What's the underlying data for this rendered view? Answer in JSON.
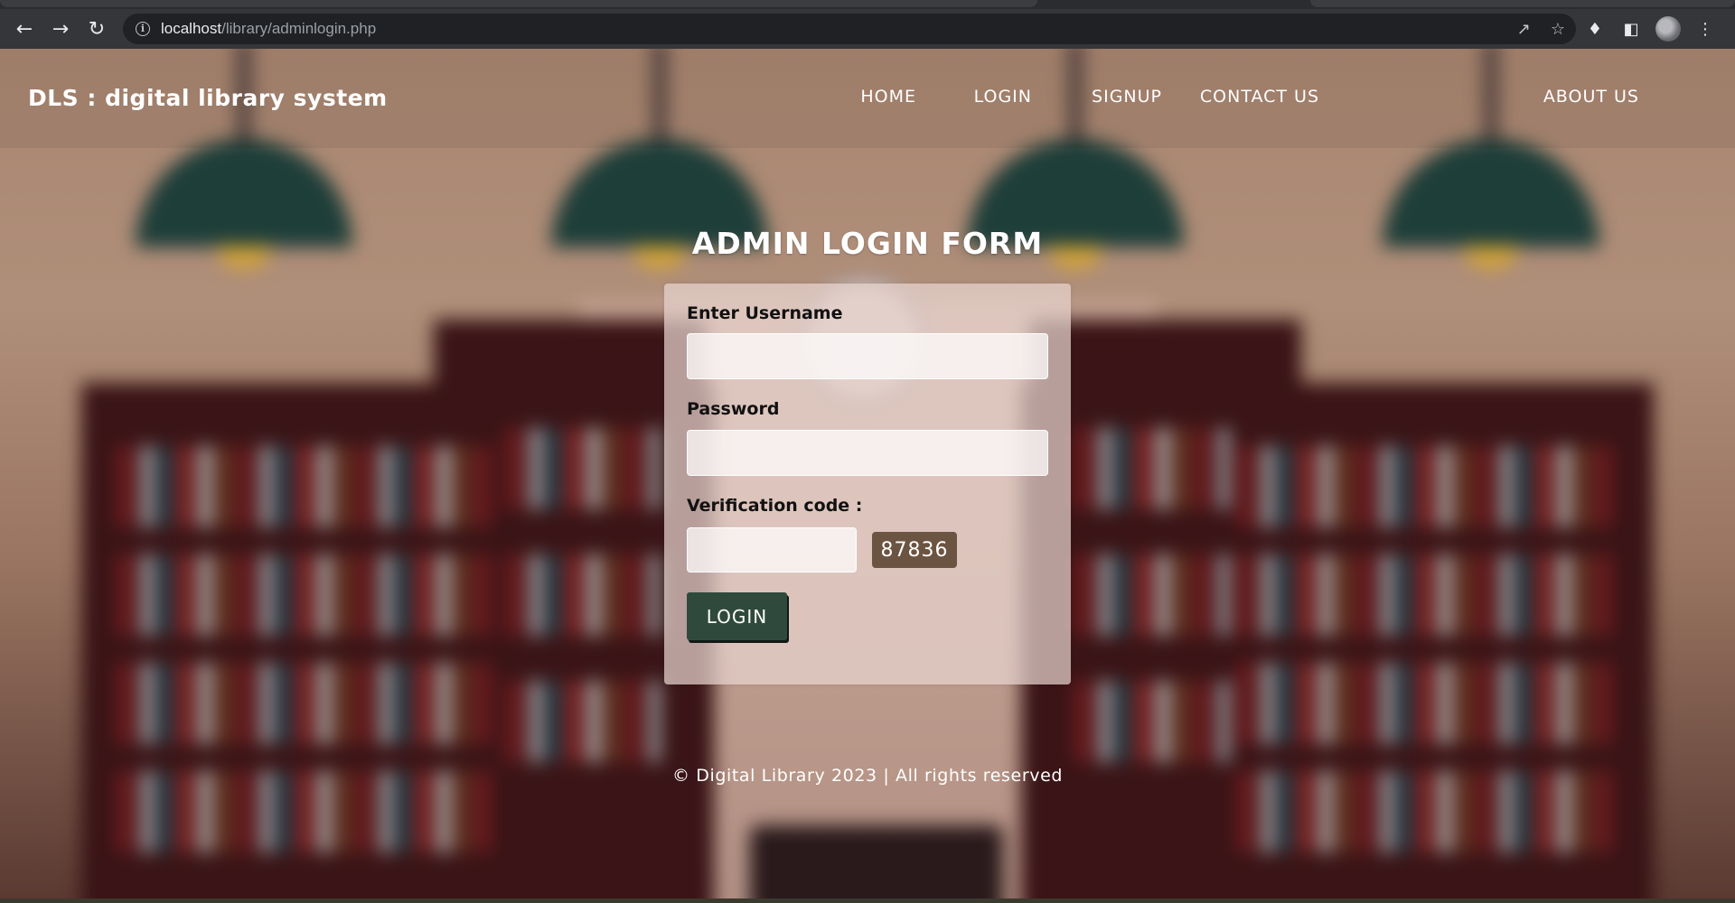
{
  "browser": {
    "url_host": "localhost",
    "url_path": "/library/adminlogin.php"
  },
  "colors": {
    "login_button": "#2f4a3c",
    "captcha_bg": "#6b5442",
    "card_bg": "#e8d4cf"
  },
  "header": {
    "brand": "DLS : digital library system",
    "nav": [
      "HOME",
      "LOGIN",
      "SIGNUP",
      "CONTACT US",
      "ABOUT US"
    ]
  },
  "form": {
    "title": "ADMIN LOGIN FORM",
    "username_label": "Enter Username",
    "username_value": "",
    "password_label": "Password",
    "password_value": "",
    "verification_label": "Verification code :",
    "verification_value": "",
    "captcha_code": "87836",
    "submit_label": "LOGIN"
  },
  "footer": {
    "text": "© Digital Library 2023 | All rights reserved"
  }
}
